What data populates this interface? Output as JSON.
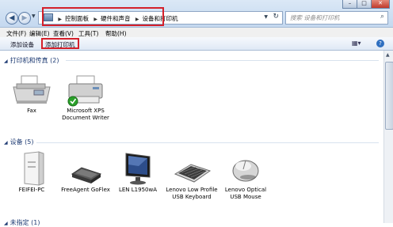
{
  "address_bar": {
    "crumbs": [
      "控制面板",
      "硬件和声音",
      "设备和打印机"
    ]
  },
  "search": {
    "placeholder": "搜索 设备和打印机"
  },
  "menu": {
    "file": "文件(F)",
    "edit": "编辑(E)",
    "view": "查看(V)",
    "tools": "工具(T)",
    "help": "帮助(H)"
  },
  "toolbar": {
    "add_device": "添加设备",
    "add_printer": "添加打印机"
  },
  "sections": {
    "printers": {
      "title": "打印机和传真 (2)"
    },
    "devices": {
      "title": "设备 (5)"
    },
    "unspecified": {
      "title": "未指定 (1)"
    }
  },
  "printers": [
    {
      "label": "Fax",
      "icon": "fax-icon"
    },
    {
      "label": "Microsoft XPS Document Writer",
      "icon": "printer-icon",
      "default": true
    }
  ],
  "devices": [
    {
      "label": "FEIFEI-PC",
      "icon": "computer-tower-icon"
    },
    {
      "label": "FreeAgent GoFlex",
      "icon": "external-drive-icon"
    },
    {
      "label": "LEN L1950wA",
      "icon": "monitor-icon"
    },
    {
      "label": "Lenovo Low Profile USB Keyboard",
      "icon": "keyboard-icon"
    },
    {
      "label": "Lenovo Optical USB Mouse",
      "icon": "mouse-icon"
    }
  ],
  "colors": {
    "highlight_box": "#d4202a",
    "section_title": "#1f3c74",
    "default_check": "#2aa12a"
  }
}
